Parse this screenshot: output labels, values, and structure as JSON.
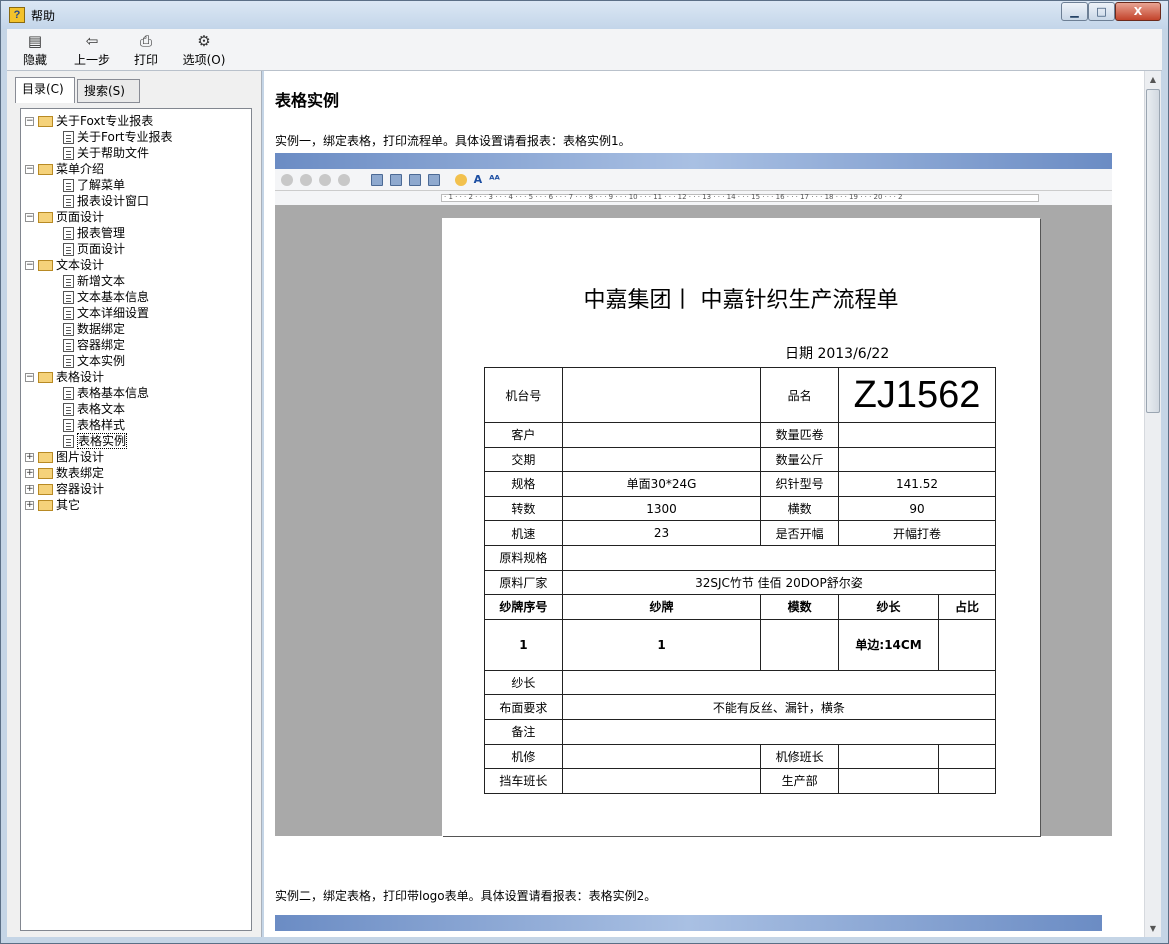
{
  "window": {
    "title": "帮助",
    "min_label": "▁",
    "max_label": "□",
    "close_label": "X"
  },
  "toolbar": {
    "hide": "隐藏",
    "back": "上一步",
    "print": "打印",
    "options": "选项(O)"
  },
  "tabs": {
    "contents": "目录(C)",
    "search": "搜索(S)"
  },
  "tree": [
    {
      "label": "关于Foxt专业报表",
      "expanded": true
    },
    {
      "label": "关于Fort专业报表",
      "child": true
    },
    {
      "label": "关于帮助文件",
      "child": true
    },
    {
      "label": "菜单介绍",
      "expanded": true
    },
    {
      "label": "了解菜单",
      "child": true
    },
    {
      "label": "报表设计窗口",
      "child": true
    },
    {
      "label": "页面设计",
      "expanded": true
    },
    {
      "label": "报表管理",
      "child": true
    },
    {
      "label": "页面设计",
      "child": true
    },
    {
      "label": "文本设计",
      "expanded": true
    },
    {
      "label": "新增文本",
      "child": true
    },
    {
      "label": "文本基本信息",
      "child": true
    },
    {
      "label": "文本详细设置",
      "child": true
    },
    {
      "label": "数据绑定",
      "child": true
    },
    {
      "label": "容器绑定",
      "child": true
    },
    {
      "label": "文本实例",
      "child": true
    },
    {
      "label": "表格设计",
      "expanded": true
    },
    {
      "label": "表格基本信息",
      "child": true
    },
    {
      "label": "表格文本",
      "child": true
    },
    {
      "label": "表格样式",
      "child": true
    },
    {
      "label": "表格实例",
      "child": true,
      "selected": true
    },
    {
      "label": "图片设计",
      "expanded": false
    },
    {
      "label": "数表绑定",
      "expanded": false
    },
    {
      "label": "容器设计",
      "expanded": false
    },
    {
      "label": "其它",
      "expanded": false
    }
  ],
  "content": {
    "heading": "表格实例",
    "example1": "实例一，绑定表格，打印流程单。具体设置请看报表：表格实例1。",
    "example2": "实例二，绑定表格，打印带logo表单。具体设置请看报表：表格实例2。",
    "ruler_text": "· 1 · · · 2 · · · 3 · · · 4 · · · 5 · · · 6 · · · 7 · · · 8 · · · 9 · · · 10 · · · 11 · · · 12 · · · 13 · · · 14 · · · 15 · · · 16 · · · 17 · · · 18 · · · 19 · · · 20 · · · 2"
  },
  "report": {
    "title": "中嘉集团丨 中嘉针织生产流程单",
    "date": "日期  2013/6/22",
    "rows": {
      "machine_no": "机台号",
      "product_name": "品名",
      "product_value": "ZJ1562",
      "customer": "客户",
      "qty_roll": "数量匹卷",
      "delivery": "交期",
      "qty_kg": "数量公斤",
      "spec": "规格",
      "spec_value": "单面30*24G",
      "loom_type": "织针型号",
      "loom_type_value": "141.52",
      "turns": "转数",
      "turns_value": "1300",
      "cross": "横数",
      "cross_value": "90",
      "speed": "机速",
      "speed_value": "23",
      "open_width": "是否开幅",
      "open_width_value": "开幅打卷",
      "material_spec": "原料规格",
      "material_maker": "原料厂家",
      "material_maker_value": "32SJC竹节 佳佰 20DOP舒尔姿",
      "yarn_no": "纱牌序号",
      "yarn_brand": "纱牌",
      "yarn_cross": "模数",
      "yarn_length": "纱长",
      "ratio": "占比",
      "yarn_no_value": "1",
      "yarn_brand_value": "1",
      "yarn_length_value": "单边:14CM",
      "yarn_len2": "纱长",
      "cloth_req": "布面要求",
      "cloth_req_value": "不能有反丝、漏针，横条",
      "remark": "备注",
      "repair": "机修",
      "repair_lead": "机修班长",
      "shift_lead": "挡车班长",
      "prod_dept": "生产部"
    }
  }
}
